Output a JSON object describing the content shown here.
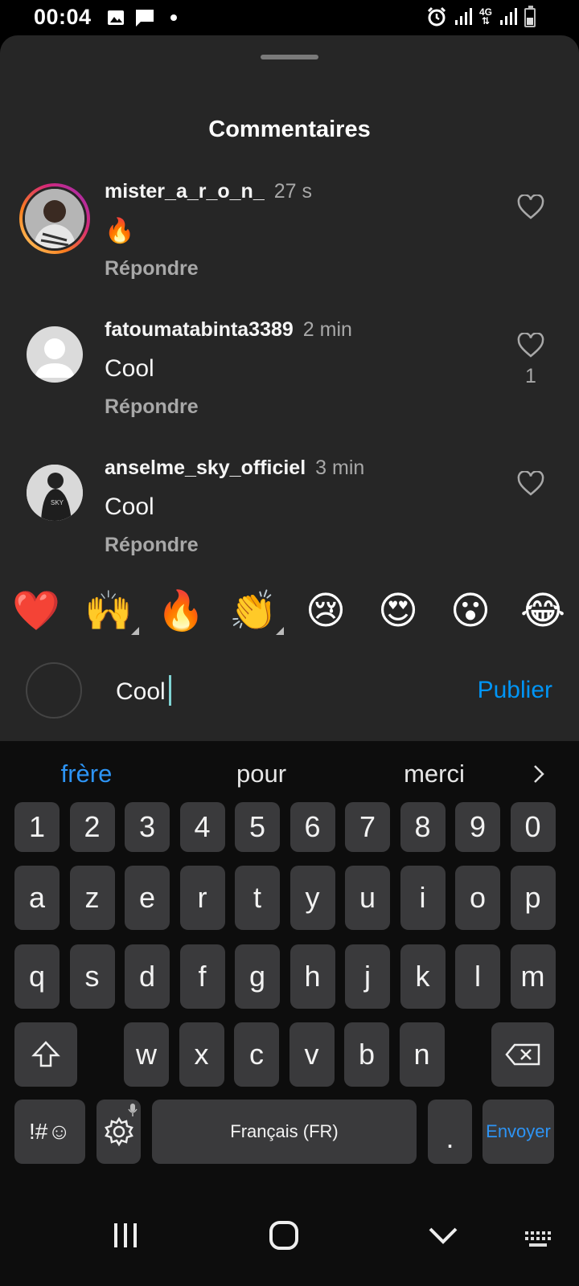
{
  "status_bar": {
    "time": "00:04",
    "left_icons": [
      "image-icon",
      "message-icon",
      "dot-icon"
    ],
    "right_icons": [
      "alarm-icon",
      "signal-icon",
      "4g-icon",
      "signal-icon",
      "battery-icon"
    ],
    "network_label": "4G"
  },
  "sheet": {
    "title": "Commentaires"
  },
  "comments": [
    {
      "username": "mister_a_r_o_n_",
      "time": "27 s",
      "text": "🔥",
      "reply": "Répondre",
      "likes": "",
      "avatar_story_ring": true
    },
    {
      "username": "fatoumatabinta3389",
      "time": "2 min",
      "text": "Cool",
      "reply": "Répondre",
      "likes": "1",
      "avatar_story_ring": false
    },
    {
      "username": "anselme_sky_officiel",
      "time": "3 min",
      "text": "Cool",
      "reply": "Répondre",
      "likes": "",
      "avatar_story_ring": false
    }
  ],
  "emoji_bar": [
    "❤️",
    "🙌",
    "🔥",
    "👏",
    "😢",
    "😍",
    "😮",
    "😂"
  ],
  "composer": {
    "value": "Cool",
    "publish_label": "Publier"
  },
  "keyboard": {
    "suggestions": [
      "frère",
      "pour",
      "merci"
    ],
    "row_numbers": [
      "1",
      "2",
      "3",
      "4",
      "5",
      "6",
      "7",
      "8",
      "9",
      "0"
    ],
    "row1": [
      "a",
      "z",
      "e",
      "r",
      "t",
      "y",
      "u",
      "i",
      "o",
      "p"
    ],
    "row2": [
      "q",
      "s",
      "d",
      "f",
      "g",
      "h",
      "j",
      "k",
      "l",
      "m"
    ],
    "row3": [
      "w",
      "x",
      "c",
      "v",
      "b",
      "n"
    ],
    "symbols_label": "!#☺",
    "space_label": "Français (FR)",
    "period_label": ".",
    "send_label": "Envoyer"
  },
  "colors": {
    "sheet_bg": "#262626",
    "accent_blue": "#0095f6",
    "keyboard_blue": "#2d94f5",
    "key_bg": "#3a3a3c"
  }
}
